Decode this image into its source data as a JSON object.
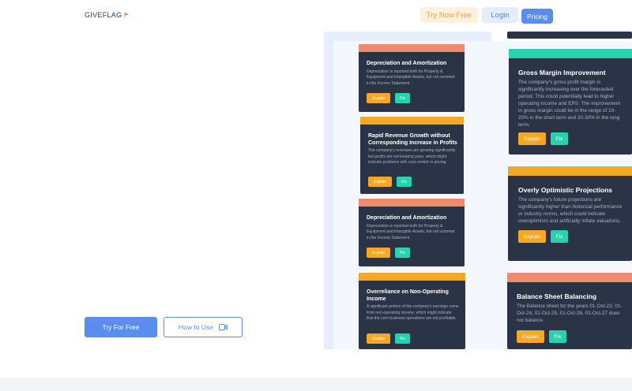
{
  "header": {
    "logo": "GIVEFLAG",
    "nav": {
      "try_now": "Try Now Free",
      "login": "Login",
      "pricing": "Pricing"
    }
  },
  "hero": {
    "try_free": "Try For Free",
    "how_to_use": "How to Use"
  },
  "cards_left": [
    {
      "title": "Depreciation and Amortization",
      "desc": "Depreciation is reported both for Property & Equipment and Intangible Assets, but not summed in the Income Statement.",
      "explain": "Explain",
      "fix": "Fix",
      "bar_color": "#f08a6e"
    },
    {
      "title": "Rapid Revenue Growth without Corresponding Increase in Profits",
      "desc": "The company's revenues are growing significantly but profits are not keeping pace, which might indicate problems with cost control or pricing.",
      "explain": "Explain",
      "fix": "Fix",
      "bar_color": "#f4a825"
    },
    {
      "title": "Depreciation and Amortization",
      "desc": "Depreciation is reported both for Property & Equipment and Intangible Assets, but not summed in the Income Statement.",
      "explain": "Explain",
      "fix": "Fix",
      "bar_color": "#f08a6e"
    },
    {
      "title": "Overreliance on Non-Operating Income",
      "desc": "A significant portion of the company's earnings come from non-operating income, which might indicate that the core business operations are not profitable.",
      "explain": "Explain",
      "fix": "Fix",
      "bar_color": "#f4a825"
    }
  ],
  "cards_right": [
    {
      "title": "Gross Margin Improvement",
      "desc": "The company's gross profit margin is significantly increasing over the forecasted period. This could potentially lead to higher operating income and EPS. The improvement in gross margin could be in the range of 10-20% in the short term and 20-30% in the long term.",
      "explain": "Explain",
      "fix": "Fix",
      "bar_color": "#27d3ae"
    },
    {
      "title": "Overly Optimistic Projections",
      "desc": "The company's future projections are significantly higher than historical performance or industry norms, which could indicate overoptimism and artificially inflate valuations.",
      "explain": "Explain",
      "fix": "Fix",
      "bar_color": "#f4a825"
    },
    {
      "title": "Balance Sheet Balancing",
      "desc": "The Balance sheet for the years 01-Oct-23, 01-Oct-24, 01-Oct-25, 01-Oct-26, 01-Oct-27 does not balance.",
      "explain": "Explain",
      "fix": "Fix",
      "bar_color": "#f08a6e"
    }
  ],
  "colors": {
    "accent": "#5b8def",
    "explain": "#f4a825",
    "fix": "#27d3ae",
    "card_bg": "#2b3446"
  }
}
